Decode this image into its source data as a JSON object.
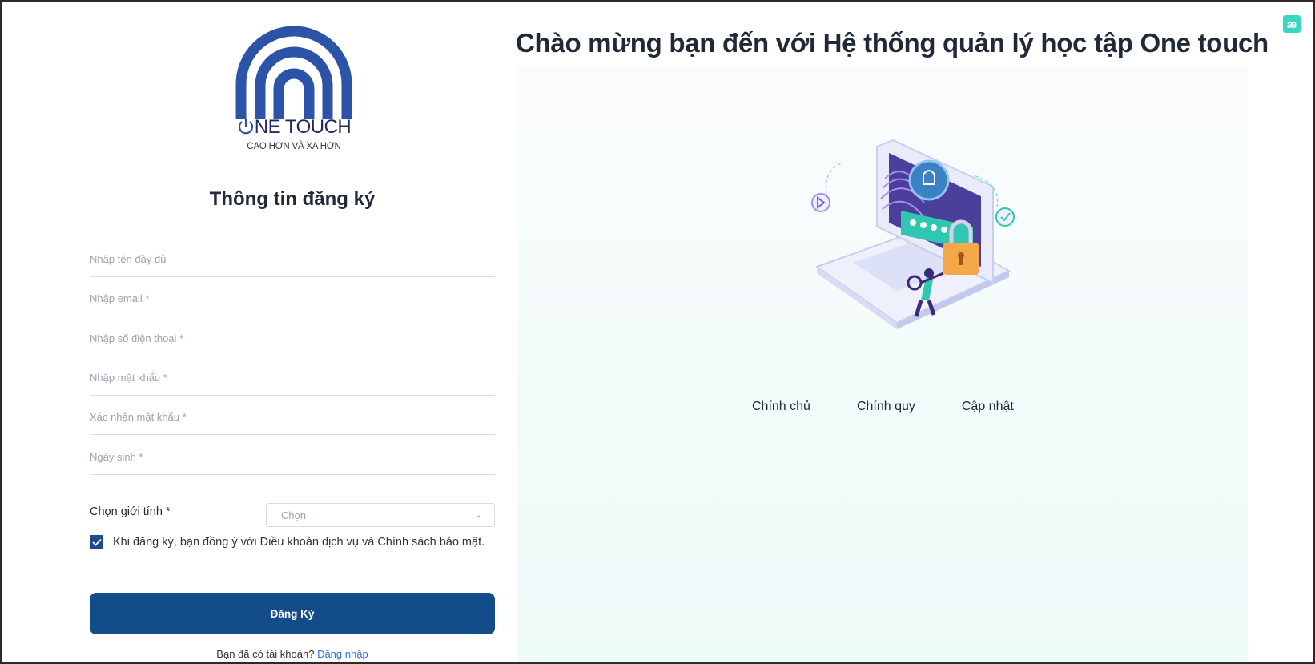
{
  "brand": {
    "name_prefix": "",
    "name_rest": "NE TOUCH",
    "tagline": "CAO HƠN VÀ XA HƠN"
  },
  "form": {
    "title": "Thông tin đăng ký",
    "fields": [
      {
        "placeholder": "Nhập tên đầy đủ",
        "value": ""
      },
      {
        "placeholder": "Nhập email *",
        "value": ""
      },
      {
        "placeholder": "Nhập số điện thoại *",
        "value": ""
      },
      {
        "placeholder": "Nhập mật khẩu *",
        "value": ""
      },
      {
        "placeholder": "Xác nhận mật khẩu *",
        "value": ""
      },
      {
        "placeholder": "Ngày sinh *",
        "value": ""
      }
    ],
    "gender_label": "Chọn giới tính *",
    "gender_select": "Chọn",
    "terms_checked": true,
    "terms_text": "Khi đăng ký, bạn đồng ý với Điều khoản dịch vụ và Chính sách bảo mật.",
    "submit_label": "Đăng Ký",
    "have_account": "Bạn đã có tài khoản? ",
    "login_link": "Đăng nhập"
  },
  "welcome": {
    "title": "Chào mừng bạn đến với Hệ thống quản lý học tập One touch",
    "features": [
      "Chính chủ",
      "Chính quy",
      "Cập nhật"
    ]
  },
  "corner_icon": {
    "name": "extension-icon",
    "glyph": "æ"
  },
  "colors": {
    "primary": "#124c8a",
    "logo_blue": "#2b53a7",
    "link": "#2f73d9",
    "accent_teal": "#39d6c4"
  }
}
